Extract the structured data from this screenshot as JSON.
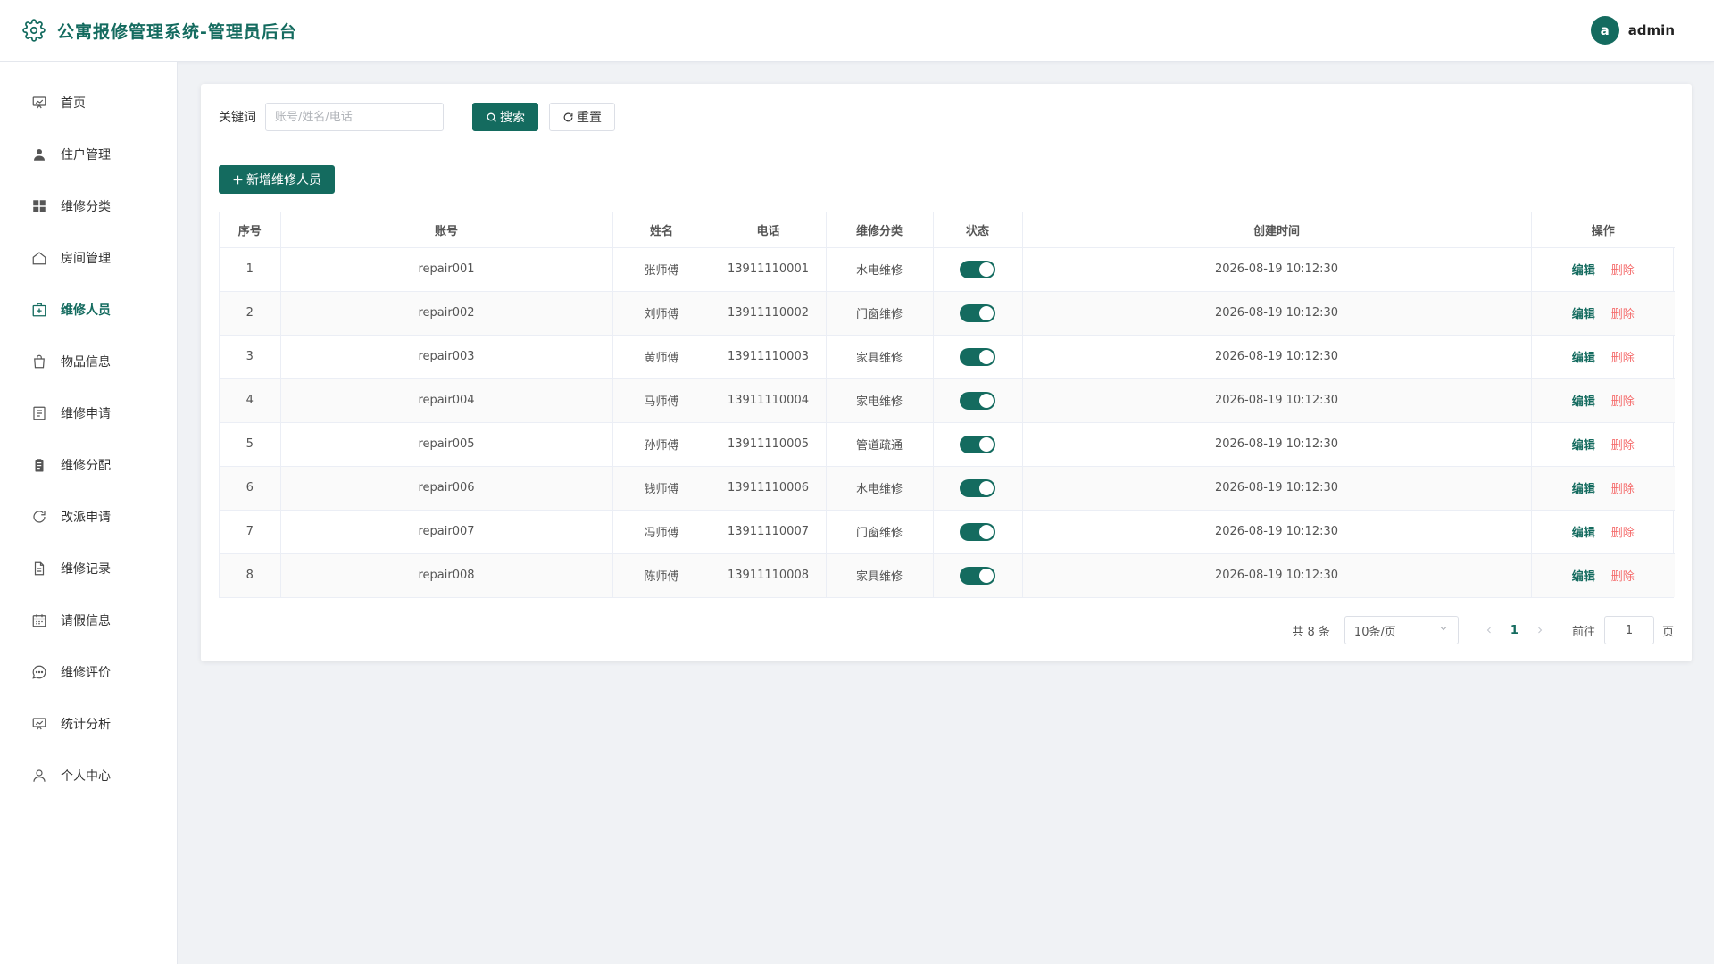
{
  "header": {
    "title": "公寓报修管理系统-管理员后台",
    "logo_icon": "gear-icon",
    "avatar_letter": "a",
    "username": "admin"
  },
  "colors": {
    "primary": "#146b5f",
    "danger": "#f56c6c"
  },
  "sidebar": {
    "items": [
      {
        "label": "首页",
        "icon": "dashboard-icon"
      },
      {
        "label": "住户管理",
        "icon": "user-icon"
      },
      {
        "label": "维修分类",
        "icon": "grid-icon"
      },
      {
        "label": "房间管理",
        "icon": "home-icon"
      },
      {
        "label": "维修人员",
        "icon": "medical-box-icon",
        "active": true
      },
      {
        "label": "物品信息",
        "icon": "shopping-bag-icon"
      },
      {
        "label": "维修申请",
        "icon": "document-icon"
      },
      {
        "label": "维修分配",
        "icon": "clipboard-icon"
      },
      {
        "label": "改派申请",
        "icon": "refresh-icon"
      },
      {
        "label": "维修记录",
        "icon": "file-icon"
      },
      {
        "label": "请假信息",
        "icon": "calendar-icon"
      },
      {
        "label": "维修评价",
        "icon": "chat-icon"
      },
      {
        "label": "统计分析",
        "icon": "chart-board-icon"
      },
      {
        "label": "个人中心",
        "icon": "person-icon"
      }
    ]
  },
  "filter": {
    "keyword_label": "关键词",
    "keyword_placeholder": "账号/姓名/电话",
    "keyword_value": "",
    "search_label": "搜索",
    "reset_label": "重置"
  },
  "toolbar": {
    "add_label": "新增维修人员"
  },
  "table": {
    "columns": [
      "序号",
      "账号",
      "姓名",
      "电话",
      "维修分类",
      "状态",
      "创建时间",
      "操作"
    ],
    "edit_label": "编辑",
    "delete_label": "删除",
    "rows": [
      {
        "index": "1",
        "account": "repair001",
        "name": "张师傅",
        "phone": "13911110001",
        "category": "水电维修",
        "enabled": true,
        "created": "2026-08-19 10:12:30"
      },
      {
        "index": "2",
        "account": "repair002",
        "name": "刘师傅",
        "phone": "13911110002",
        "category": "门窗维修",
        "enabled": true,
        "created": "2026-08-19 10:12:30"
      },
      {
        "index": "3",
        "account": "repair003",
        "name": "黄师傅",
        "phone": "13911110003",
        "category": "家具维修",
        "enabled": true,
        "created": "2026-08-19 10:12:30"
      },
      {
        "index": "4",
        "account": "repair004",
        "name": "马师傅",
        "phone": "13911110004",
        "category": "家电维修",
        "enabled": true,
        "created": "2026-08-19 10:12:30"
      },
      {
        "index": "5",
        "account": "repair005",
        "name": "孙师傅",
        "phone": "13911110005",
        "category": "管道疏通",
        "enabled": true,
        "created": "2026-08-19 10:12:30"
      },
      {
        "index": "6",
        "account": "repair006",
        "name": "钱师傅",
        "phone": "13911110006",
        "category": "水电维修",
        "enabled": true,
        "created": "2026-08-19 10:12:30"
      },
      {
        "index": "7",
        "account": "repair007",
        "name": "冯师傅",
        "phone": "13911110007",
        "category": "门窗维修",
        "enabled": true,
        "created": "2026-08-19 10:12:30"
      },
      {
        "index": "8",
        "account": "repair008",
        "name": "陈师傅",
        "phone": "13911110008",
        "category": "家具维修",
        "enabled": true,
        "created": "2026-08-19 10:12:30"
      }
    ]
  },
  "pagination": {
    "total_text": "共 8 条",
    "page_size_text": "10条/页",
    "current_page": "1",
    "goto_label": "前往",
    "goto_value": "1",
    "page_suffix": "页"
  }
}
